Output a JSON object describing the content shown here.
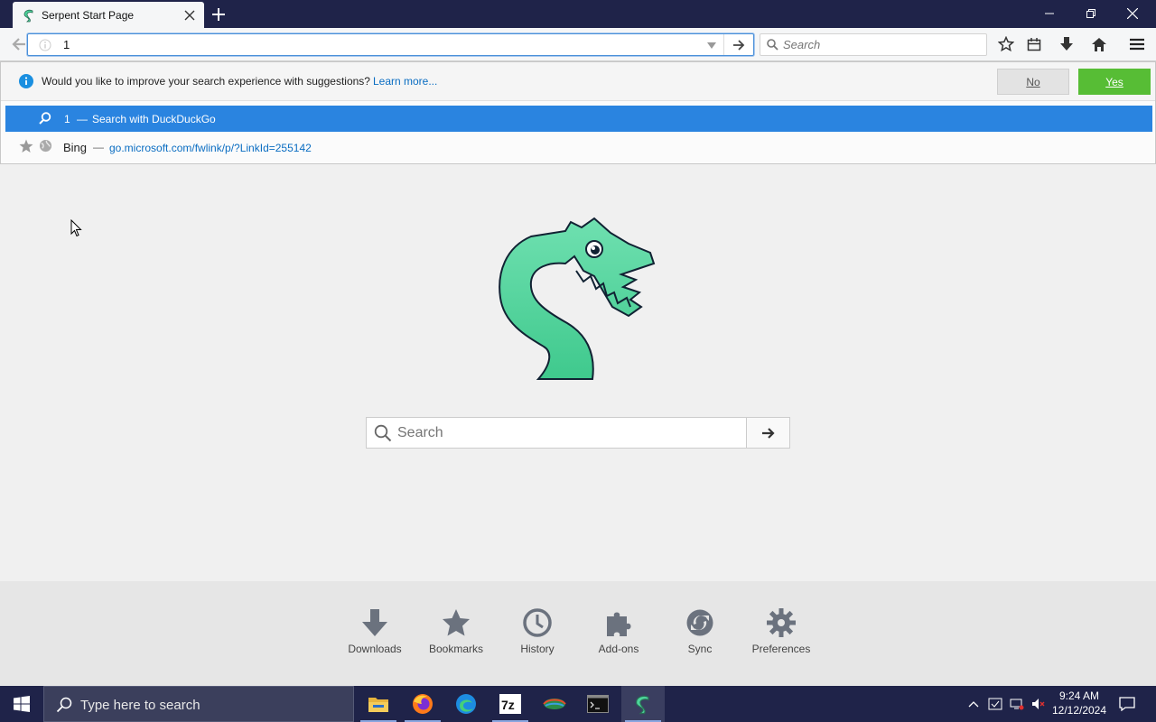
{
  "window": {
    "tab_title": "Serpent Start Page"
  },
  "navbar": {
    "url_value": "1",
    "search_placeholder": "Search"
  },
  "suggestions_prompt": {
    "question": "Would you like to improve your search experience with suggestions?",
    "learn_more": "Learn more...",
    "no_label": "No",
    "yes_label": "Yes"
  },
  "results": [
    {
      "query": "1",
      "separator": "—",
      "action": "Search with DuckDuckGo",
      "icon": "search-icon"
    },
    {
      "title": "Bing",
      "separator": "—",
      "url": "go.microsoft.com/fwlink/p/?LinkId=255142",
      "icon": "globe-icon"
    }
  ],
  "page": {
    "search_placeholder": "Search"
  },
  "launcher": [
    {
      "label": "Downloads",
      "icon": "download-icon"
    },
    {
      "label": "Bookmarks",
      "icon": "star-icon"
    },
    {
      "label": "History",
      "icon": "clock-icon"
    },
    {
      "label": "Add-ons",
      "icon": "puzzle-icon"
    },
    {
      "label": "Sync",
      "icon": "sync-icon"
    },
    {
      "label": "Preferences",
      "icon": "gear-icon"
    }
  ],
  "taskbar": {
    "search_placeholder": "Type here to search",
    "time": "9:24 AM",
    "date": "12/12/2024",
    "apps": [
      "file-explorer",
      "firefox",
      "edge",
      "7-zip",
      "app",
      "terminal",
      "serpent"
    ]
  },
  "colors": {
    "chrome_dark": "#1f2349",
    "selected_row": "#2a84e0",
    "yes_button": "#57bd35",
    "logo_green": "#4cd49a"
  }
}
